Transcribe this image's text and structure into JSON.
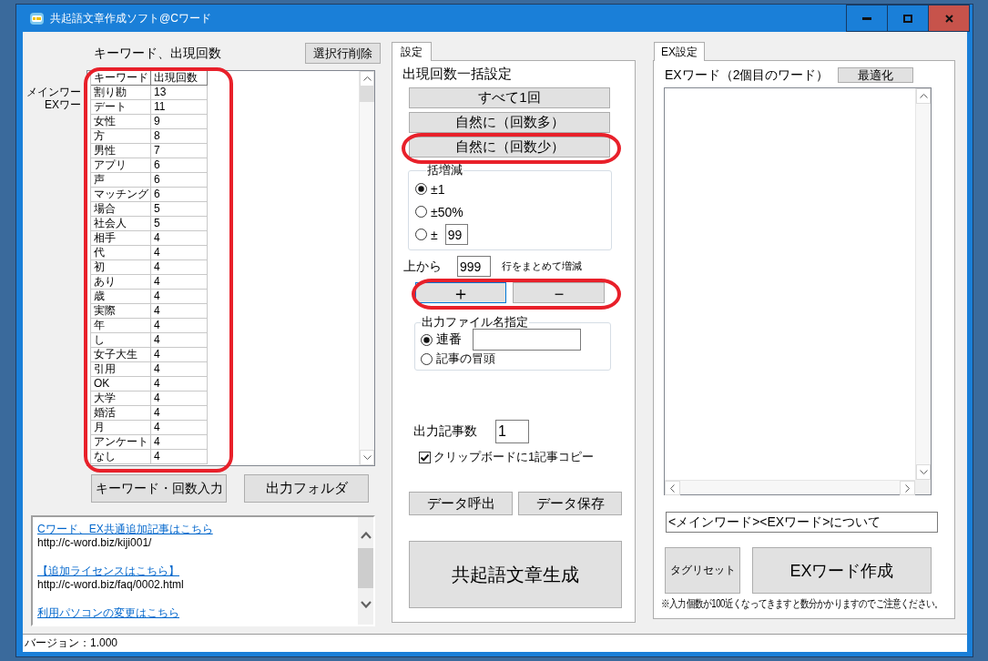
{
  "window": {
    "title": "共起語文章作成ソフト@Cワード"
  },
  "keywords": {
    "heading": "キーワード、出現回数",
    "delete_button": "選択行削除",
    "side_labels": [
      "メインワー",
      "EXワー"
    ],
    "columns": [
      "キーワード",
      "出現回数"
    ],
    "rows": [
      [
        "割り勘",
        "13"
      ],
      [
        "デート",
        "11"
      ],
      [
        "女性",
        "9"
      ],
      [
        "方",
        "8"
      ],
      [
        "男性",
        "7"
      ],
      [
        "アプリ",
        "6"
      ],
      [
        "声",
        "6"
      ],
      [
        "マッチング",
        "6"
      ],
      [
        "場合",
        "5"
      ],
      [
        "社会人",
        "5"
      ],
      [
        "相手",
        "4"
      ],
      [
        "代",
        "4"
      ],
      [
        "初",
        "4"
      ],
      [
        "あり",
        "4"
      ],
      [
        "歳",
        "4"
      ],
      [
        "実際",
        "4"
      ],
      [
        "年",
        "4"
      ],
      [
        "し",
        "4"
      ],
      [
        "女子大生",
        "4"
      ],
      [
        "引用",
        "4"
      ],
      [
        "OK",
        "4"
      ],
      [
        "大学",
        "4"
      ],
      [
        "婚活",
        "4"
      ],
      [
        "月",
        "4"
      ],
      [
        "アンケート",
        "4"
      ],
      [
        "なし",
        "4"
      ]
    ],
    "buttons": [
      "キーワード・回数入力",
      "出力フォルダ"
    ]
  },
  "links": [
    {
      "title": "Cワード、EX共通追加記事はこちら",
      "url": "http://c-word.biz/kiji001/"
    },
    {
      "title": "【追加ライセンスはこちら】",
      "url": "http://c-word.biz/faq/0002.html"
    },
    {
      "title": "利用パソコンの変更はこちら"
    }
  ],
  "settings": {
    "tab": {
      "label": "設定",
      "selected": true
    },
    "heading": "出現回数一括設定",
    "preset_buttons": [
      "すべて1回",
      "自然に（回数多）",
      "自然に（回数少）"
    ],
    "adjust_group": {
      "legend": "括増減",
      "options": [
        {
          "kind": "plain",
          "label": "±1",
          "selected": true
        },
        {
          "kind": "plain",
          "label": "±50%",
          "selected": false
        },
        {
          "kind": "field",
          "label": "±",
          "value": "99",
          "selected": false
        }
      ]
    },
    "range": {
      "prefix": "上から",
      "value": "999",
      "suffix": "行をまとめて増減"
    },
    "step_buttons": [
      {
        "label": "＋",
        "focused": true
      },
      {
        "label": "－",
        "focused": false
      }
    ],
    "filename_group": {
      "legend": "出力ファイル名指定",
      "options": [
        {
          "kind": "field",
          "label": "連番",
          "selected": true
        },
        {
          "kind": "plain",
          "label": "記事の冒頭",
          "selected": false
        }
      ]
    },
    "count": {
      "label": "出力記事数",
      "value": "1"
    },
    "clipboard": {
      "label": "クリップボードに1記事コピー",
      "checked": true
    },
    "data_buttons": [
      "データ呼出",
      "データ保存"
    ],
    "generate_button": "共起語文章生成"
  },
  "ex_settings": {
    "tab": {
      "label": "EX設定",
      "selected": true
    },
    "heading": "EXワード（2個目のワード）",
    "optimize_button": "最適化",
    "template": {
      "value": "<メインワード><EXワード>について"
    },
    "reset_button": "タグリセット",
    "create_button": "EXワード作成",
    "note": "※入力個数が100近くなってきますと数分かかりますのでご注意ください。"
  },
  "status_bar": {
    "text": "バージョン：1.000"
  }
}
